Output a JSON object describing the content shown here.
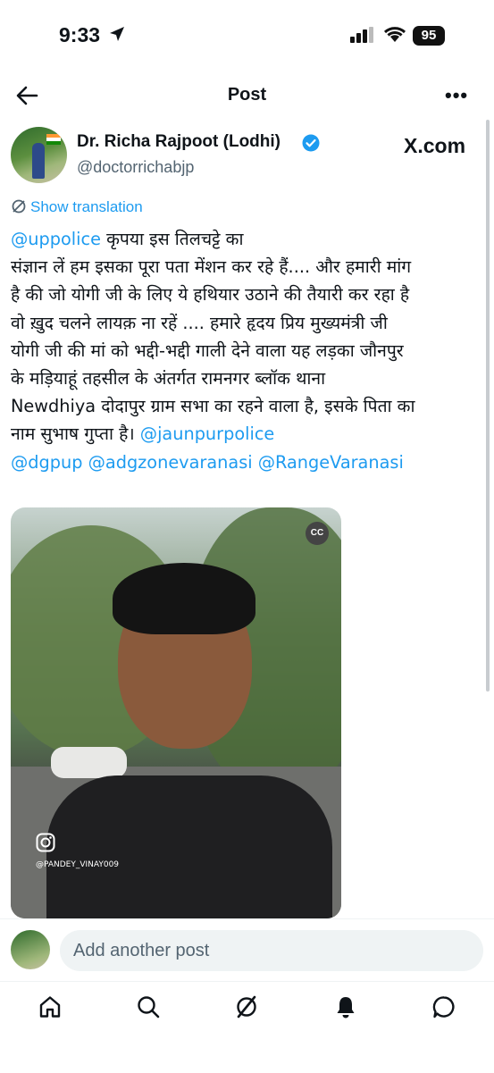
{
  "status_bar": {
    "time": "9:33",
    "battery": "95"
  },
  "header": {
    "title": "Post"
  },
  "author": {
    "name": "Dr. Richa Rajpoot (Lodhi)",
    "handle": "@doctorrichabjp"
  },
  "brand": "X.com",
  "show_translation": "Show translation",
  "tweet": {
    "mention1": "@uppolice",
    "line1": " कृपया इस तिलचट्टे का",
    "body": "संज्ञान लें हम इसका पूरा पता मेंशन कर रहे हैं.... और हमारी मांग\nहै की जो  योगी जी के लिए ये हथियार उठाने की तैयारी कर रहा है\nवो ख़ुद चलने लायक़ ना रहें .... हमारे हृदय प्रिय मुख्यमंत्री जी\nयोगी जी की मां को भद्दी-भद्दी गाली देने वाला यह लड़का जौनपुर\nके मड़ियाहूं तहसील के अंतर्गत रामनगर ब्लॉक थाना\nNewdhiya दोदापुर ग्राम सभा का रहने वाला है, इसके पिता का\nनाम सुभाष गुप्ता है। ",
    "mention2": "@jaunpurpolice",
    "mention3": "@dgpup",
    "mention4": "@adgzonevaranasi",
    "mention5": "@RangeVaranasi"
  },
  "video": {
    "watermark": "@PANDEY_VINAY009",
    "cc": "CC"
  },
  "compose": {
    "placeholder": "Add another post"
  },
  "icons": {
    "back": "back-arrow-icon",
    "more": "more-icon",
    "verified": "verified-badge-icon",
    "home": "home-icon",
    "search": "search-icon",
    "grok": "grok-icon",
    "notifications": "bell-icon",
    "messages": "message-icon"
  },
  "colors": {
    "accent": "#1d9bf0",
    "text": "#0f1419",
    "secondary": "#536471"
  }
}
